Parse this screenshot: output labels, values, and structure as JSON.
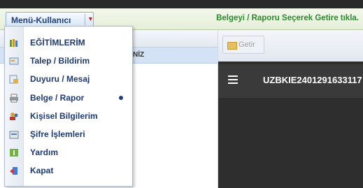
{
  "menubar": {
    "menu_button_label": "Menü-Kullanıcı",
    "hint_text": "Belgeyi / Raporu Seçerek Getire tıkla."
  },
  "grid": {
    "selected_row_text": "NİZ"
  },
  "toolbar": {
    "getir_label": "Getir"
  },
  "viewer": {
    "document_id": "UZBKIE2401291633117"
  },
  "dropdown": {
    "items": [
      {
        "label": "EĞİTİMLERİM",
        "icon": "books-icon"
      },
      {
        "label": "Talep / Bildirim",
        "icon": "request-icon"
      },
      {
        "label": "Duyuru / Mesaj",
        "icon": "message-icon"
      },
      {
        "label": "Belge / Rapor",
        "icon": "printer-icon"
      },
      {
        "label": "Kişisel Bilgilerim",
        "icon": "users-icon"
      },
      {
        "label": "Şifre İşlemleri",
        "icon": "password-icon"
      },
      {
        "label": "Yardım",
        "icon": "help-icon"
      },
      {
        "label": "Kapat",
        "icon": "exit-icon"
      }
    ]
  },
  "colors": {
    "hint_green": "#2b8a2b",
    "menu_text": "#1e3a6e",
    "viewer_dark": "#2e2e2e"
  }
}
